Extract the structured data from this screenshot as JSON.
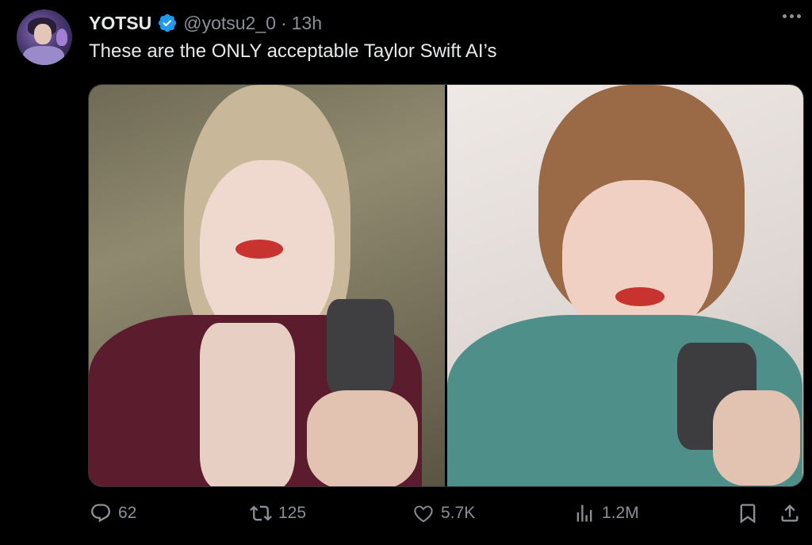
{
  "tweet": {
    "author_name": "YOTSU",
    "handle": "@yotsu2_0",
    "separator": "·",
    "time": "13h",
    "text": "These are the ONLY acceptable Taylor Swift AI’s"
  },
  "actions": {
    "replies": "62",
    "reposts": "125",
    "likes": "5.7K",
    "views": "1.2M"
  },
  "colors": {
    "background": "#000000",
    "primary_text": "#e7e9ea",
    "secondary_text": "#8b9096",
    "verified": "#1d9bf0"
  },
  "icons": [
    "verified-badge-icon",
    "more-options-icon",
    "reply-icon",
    "repost-icon",
    "like-icon",
    "views-icon",
    "bookmark-icon",
    "share-icon"
  ]
}
